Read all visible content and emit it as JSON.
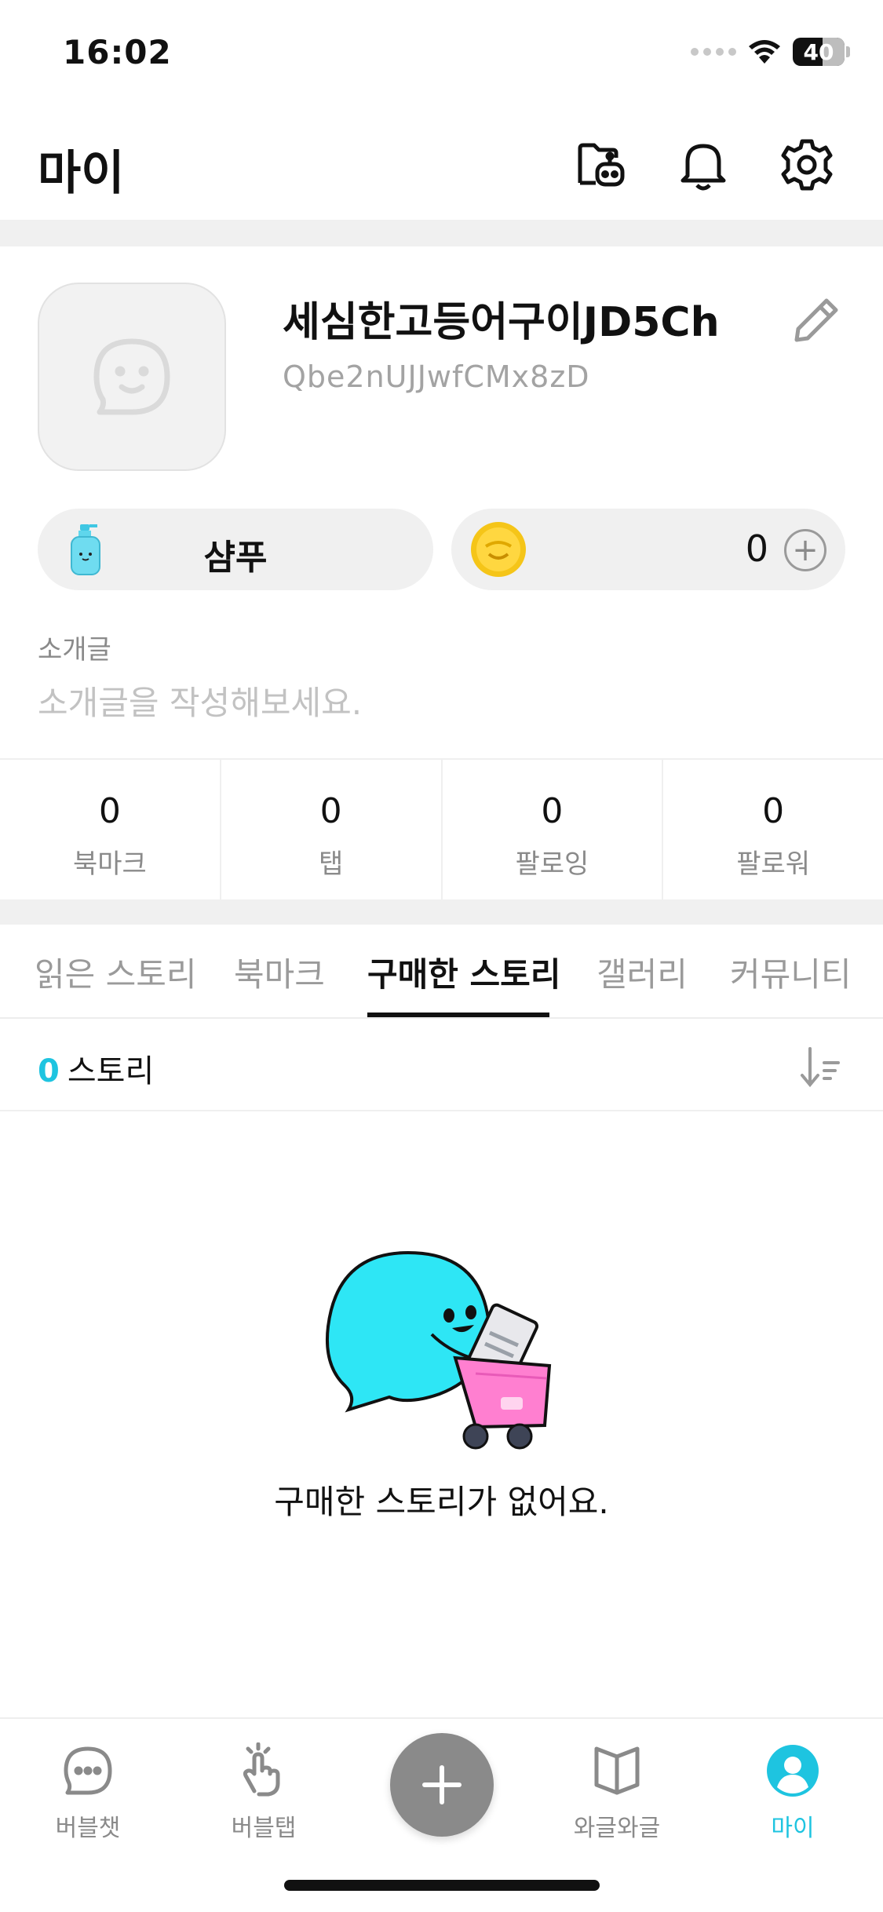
{
  "status_bar": {
    "time": "16:02",
    "battery": "40"
  },
  "header": {
    "title": "마이"
  },
  "profile": {
    "nickname": "세심한고등어구이JD5Ch",
    "user_id": "Qbe2nUJJwfCMx8zD",
    "item_label": "샴푸",
    "coin_count": "0",
    "intro_label": "소개글",
    "intro_placeholder": "소개글을 작성해보세요."
  },
  "stats": [
    {
      "value": "0",
      "label": "북마크"
    },
    {
      "value": "0",
      "label": "탭"
    },
    {
      "value": "0",
      "label": "팔로잉"
    },
    {
      "value": "0",
      "label": "팔로워"
    }
  ],
  "tabs": [
    {
      "label": "읽은 스토리"
    },
    {
      "label": "북마크"
    },
    {
      "label": "구매한 스토리",
      "active": true
    },
    {
      "label": "갤러리"
    },
    {
      "label": "커뮤니티"
    }
  ],
  "list": {
    "count": "0",
    "unit": "스토리"
  },
  "empty_state": {
    "message": "구매한 스토리가 없어요."
  },
  "bottom_nav": [
    {
      "label": "버블챗",
      "icon": "chat-bubble-icon"
    },
    {
      "label": "버블탭",
      "icon": "tap-hand-icon"
    },
    {
      "label": "와글와글",
      "icon": "open-book-icon"
    },
    {
      "label": "마이",
      "icon": "profile-icon",
      "active": true
    }
  ],
  "colors": {
    "accent": "#1ec4e0",
    "muted": "#8a8a8a",
    "fab": "#8a8a8a"
  }
}
